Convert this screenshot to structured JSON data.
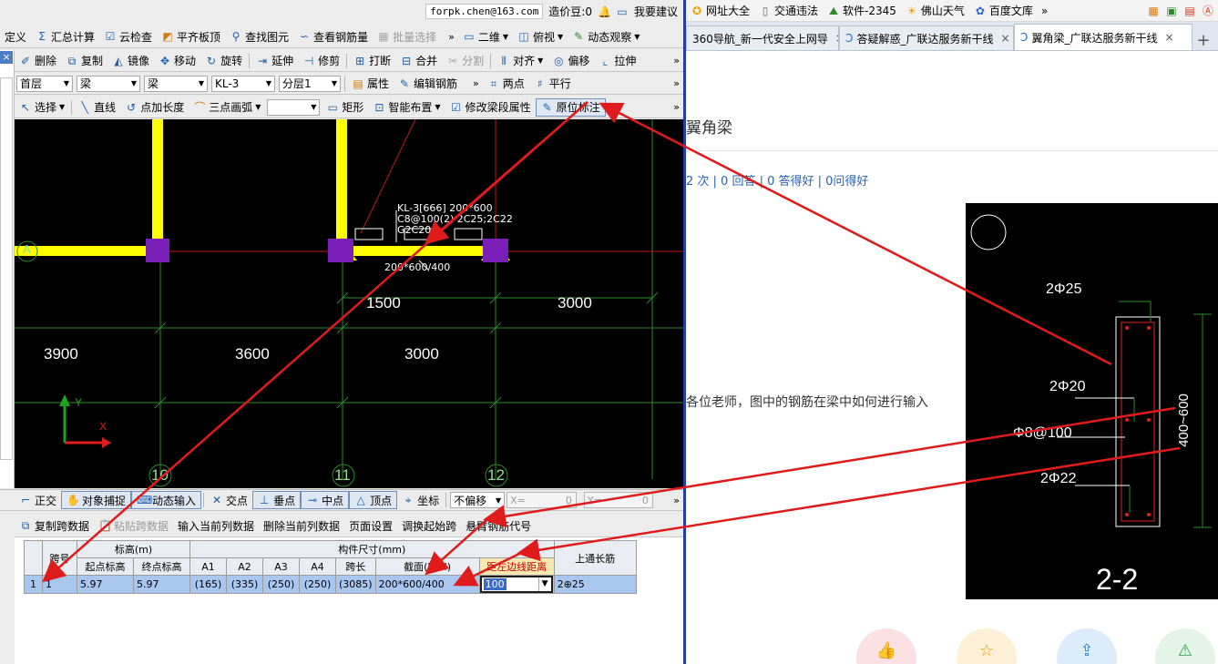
{
  "app": {
    "account": {
      "email": "forpk.chen@163.com",
      "coins": "造价豆:0",
      "feedback": "我要建议"
    },
    "toolbar1": [
      "定义",
      "汇总计算",
      "云检查",
      "平齐板顶",
      "查找图元",
      "查看钢筋量",
      "批量选择",
      "二维",
      "俯视",
      "动态观察"
    ],
    "toolbar2": [
      "删除",
      "复制",
      "镜像",
      "移动",
      "旋转",
      "延伸",
      "修剪",
      "打断",
      "合并",
      "分割",
      "对齐",
      "偏移",
      "拉伸"
    ],
    "toolbar3": {
      "floor": "首层",
      "type": "梁",
      "subtype": "梁",
      "element": "KL-3",
      "layer": "分层1",
      "props": "属性",
      "edit": "编辑钢筋",
      "twopoint": "两点",
      "parallel": "平行"
    },
    "toolbar4": [
      "选择",
      "直线",
      "点加长度",
      "三点画弧",
      "矩形",
      "智能布置",
      "修改梁段属性",
      "原位标注"
    ],
    "canvas": {
      "axis_a": "A",
      "axis_numbers": [
        "10",
        "11",
        "12"
      ],
      "dims_lower": [
        "3900",
        "3600",
        "3000"
      ],
      "dims_upper": [
        "1500",
        "3000"
      ],
      "beam_label": [
        "KL-3[666] 200*600",
        "C8@100(2) 2C25;2C22",
        "G2C20"
      ],
      "beam_section": "200*600/400",
      "ucs_y": "Y",
      "ucs_x": "X"
    },
    "snapbar": {
      "ortho": "正交",
      "snap": "对象捕捉",
      "dynamic": "动态输入",
      "intersection": "交点",
      "perp": "垂点",
      "mid": "中点",
      "vertex": "顶点",
      "coord": "坐标",
      "offset_mode": "不偏移",
      "x_label": "X=",
      "x_val": "0",
      "y_label": "Y=",
      "y_val": "0"
    },
    "gridtools": [
      "复制跨数据",
      "粘贴跨数据",
      "输入当前列数据",
      "删除当前列数据",
      "页面设置",
      "调换起始跨",
      "悬臂钢筋代号"
    ],
    "grid": {
      "headers_top": [
        "跨号",
        "标高(m)",
        "构件尺寸(mm)",
        "上通长筋"
      ],
      "headers_sub": [
        "起点标高",
        "终点标高",
        "A1",
        "A2",
        "A3",
        "A4",
        "跨长",
        "截面(B*H)",
        "距左边线距离"
      ],
      "row": {
        "num": "1",
        "span": "1",
        "start": "5.97",
        "end": "5.97",
        "a1": "(165)",
        "a2": "(335)",
        "a3": "(250)",
        "a4": "(250)",
        "len": "(3085)",
        "section": "200*600/400",
        "dist": "100",
        "top": "2⊕25"
      }
    }
  },
  "browser": {
    "bookmarks": [
      "网址大全",
      "交通违法",
      "软件-2345",
      "佛山天气",
      "百度文库"
    ],
    "tabs": [
      {
        "label": "360导航_新一代安全上网导",
        "active": false
      },
      {
        "label": "答疑解惑_广联达服务新干线",
        "active": false
      },
      {
        "label": "翼角梁_广联达服务新干线",
        "active": true
      }
    ],
    "title": "翼角梁",
    "stats": "2 次 | 0 回答 | 0 答得好 | 0问得好",
    "question": "各位老师，图中的钢筋在梁中如何进行输入",
    "section": {
      "top_bar": "2Φ25",
      "mid_bar": "2Φ20",
      "stirrup": "Φ8@100",
      "bot_bar": "2Φ22",
      "dim": "400~600",
      "name": "2-2"
    }
  },
  "colors": {
    "annotation": "#e01b1b",
    "beam": "#ffff00",
    "column": "#7a1fb8",
    "grid": "#2f8f2f",
    "accent": "#1f3fae"
  }
}
